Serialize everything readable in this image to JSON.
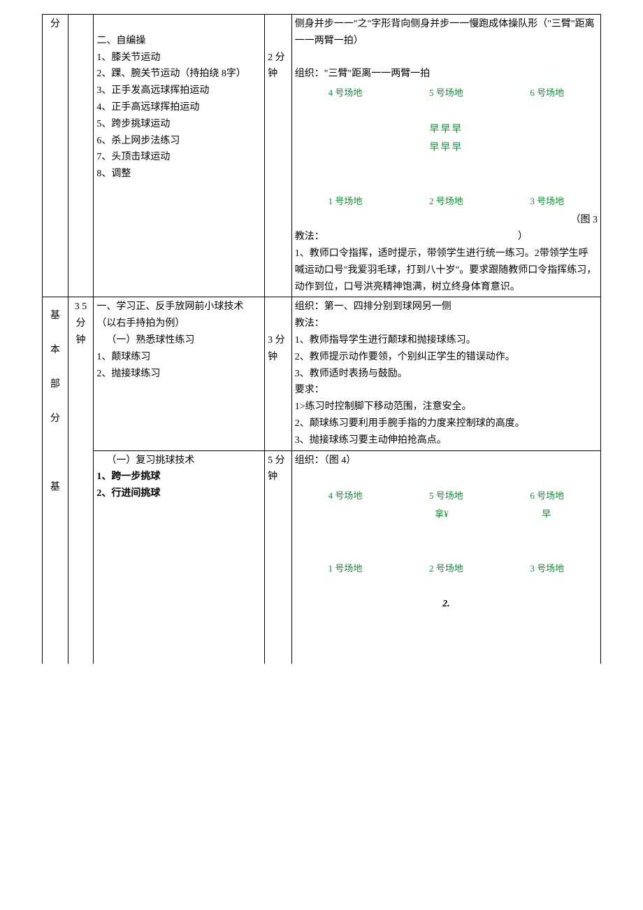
{
  "row1": {
    "col1": "分",
    "content_heading": "二、自编操",
    "content_items": [
      "1、膝关节运动",
      "2、踝、腕关节运动（持拍绕 8字）",
      "3、正手发高远球挥拍运动",
      "4、正手高远球挥拍运动",
      "5、跨步挑球运动",
      "6、杀上网步法练习",
      "7、头顶击球运动",
      "8、调整"
    ],
    "time": "2 分钟",
    "right_intro": "侧身并步一一\"之\"字形背向侧身并步一一慢跑成体操队形（\"三臂\"距离一一两臂一拍）",
    "organize": "组织：\"三臂\"距离一一两臂一拍",
    "courts_top": [
      "4 号场地",
      "5 号场地",
      "6 号场地"
    ],
    "mid_symbols": [
      "早早早",
      "早早早"
    ],
    "courts_bottom": [
      "1 号场地",
      "2 号场地",
      "3 号场地"
    ],
    "fig_label_a": "（图 3",
    "fig_label_b": "）",
    "teach_heading": "教法：",
    "teach_lines": [
      "1、教师口令指挥，适时提示，带领学生进行统一练习。2带领学生呼喊运动口号\"我爱羽毛球，打到八十岁\"。要求跟随教师口令指挥练习，动作到位，口号洪亮精神饱满，树立终身体育意识。"
    ]
  },
  "row2": {
    "col1_lines": [
      "基",
      "本",
      "部",
      "分",
      "基"
    ],
    "col2": "3 5 分钟",
    "section_a": {
      "heading": "一、学习正、反手放网前小球技术（以右手持拍为例）",
      "sub1": "（一）熟悉球性练习",
      "items": [
        "1、颠球练习",
        "2、抛接球练习"
      ],
      "time": "3 分钟",
      "right": {
        "org": "组织：第一、四排分别到球网另一侧",
        "teach": "教法：",
        "teach_items": [
          "1、教师指导学生进行颠球和抛接球练习。",
          "2、教师提示动作要领，个别纠正学生的错误动作。",
          "3、教师适时表扬与鼓励。"
        ],
        "req": "要求：",
        "req_items": [
          "1>练习时控制脚下移动范围，注意安全。",
          "2、颠球练习要利用手腕手指的力度来控制球的高度。",
          "3、抛接球练习要主动伸拍抢高点。"
        ]
      }
    },
    "section_b": {
      "heading": "（一）复习挑球技术",
      "items": [
        "1、跨一步挑球",
        "2、行进间挑球"
      ],
      "time": "5 分钟",
      "right": {
        "org": "组织：（图 4）",
        "courts_top": [
          "4 号场地",
          "5 号场地",
          "6 号场地"
        ],
        "mid_symbols": [
          "拿¥",
          "早"
        ],
        "courts_bottom": [
          "1 号场地",
          "2 号场地",
          "3 号场地"
        ],
        "footer": "2."
      }
    }
  }
}
